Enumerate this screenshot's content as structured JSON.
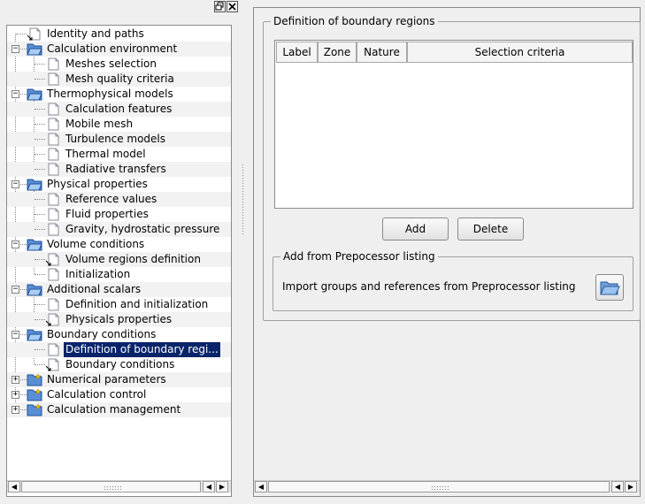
{
  "dock": {
    "float_icon": "float-icon",
    "close_icon": "close-icon"
  },
  "tree": {
    "items": [
      {
        "label": "Identity and paths",
        "level": 0,
        "type": "leaf-link"
      },
      {
        "label": "Calculation environment",
        "level": 0,
        "type": "folder-open"
      },
      {
        "label": "Meshes selection",
        "level": 1,
        "type": "page"
      },
      {
        "label": "Mesh quality criteria",
        "level": 1,
        "type": "page"
      },
      {
        "label": "Thermophysical models",
        "level": 0,
        "type": "folder-open"
      },
      {
        "label": "Calculation features",
        "level": 1,
        "type": "page"
      },
      {
        "label": "Mobile mesh",
        "level": 1,
        "type": "page"
      },
      {
        "label": "Turbulence models",
        "level": 1,
        "type": "page"
      },
      {
        "label": "Thermal model",
        "level": 1,
        "type": "page"
      },
      {
        "label": "Radiative transfers",
        "level": 1,
        "type": "page"
      },
      {
        "label": "Physical properties",
        "level": 0,
        "type": "folder-open"
      },
      {
        "label": "Reference values",
        "level": 1,
        "type": "page"
      },
      {
        "label": "Fluid properties",
        "level": 1,
        "type": "page"
      },
      {
        "label": "Gravity, hydrostatic pressure",
        "level": 1,
        "type": "page"
      },
      {
        "label": "Volume conditions",
        "level": 0,
        "type": "folder-open"
      },
      {
        "label": "Volume regions definition",
        "level": 1,
        "type": "page-link"
      },
      {
        "label": "Initialization",
        "level": 1,
        "type": "page"
      },
      {
        "label": "Additional scalars",
        "level": 0,
        "type": "folder-open"
      },
      {
        "label": "Definition and initialization",
        "level": 1,
        "type": "page"
      },
      {
        "label": "Physicals properties",
        "level": 1,
        "type": "page-link"
      },
      {
        "label": "Boundary conditions",
        "level": 0,
        "type": "folder-open"
      },
      {
        "label": "Definition of boundary regi...",
        "level": 1,
        "type": "page",
        "selected": true
      },
      {
        "label": "Boundary conditions",
        "level": 1,
        "type": "page-link"
      },
      {
        "label": "Numerical parameters",
        "level": 0,
        "type": "folder-closed"
      },
      {
        "label": "Calculation control",
        "level": 0,
        "type": "folder-closed"
      },
      {
        "label": "Calculation management",
        "level": 0,
        "type": "folder-closed"
      }
    ]
  },
  "boundary": {
    "title": "Definition of boundary regions",
    "columns": [
      "Label",
      "Zone",
      "Nature",
      "Selection criteria"
    ],
    "add_label": "Add",
    "delete_label": "Delete",
    "preprocessor": {
      "title": "Add from Prepocessor listing",
      "text": "Import groups and references from Preprocessor listing",
      "button_icon": "folder-open-icon"
    }
  },
  "scroll": {
    "left_arrow": "◀",
    "right_arrow": "▶"
  },
  "colors": {
    "selection": "#0a246a",
    "folder_blue": "#3a78c9",
    "folder_star": "#f0c000"
  }
}
